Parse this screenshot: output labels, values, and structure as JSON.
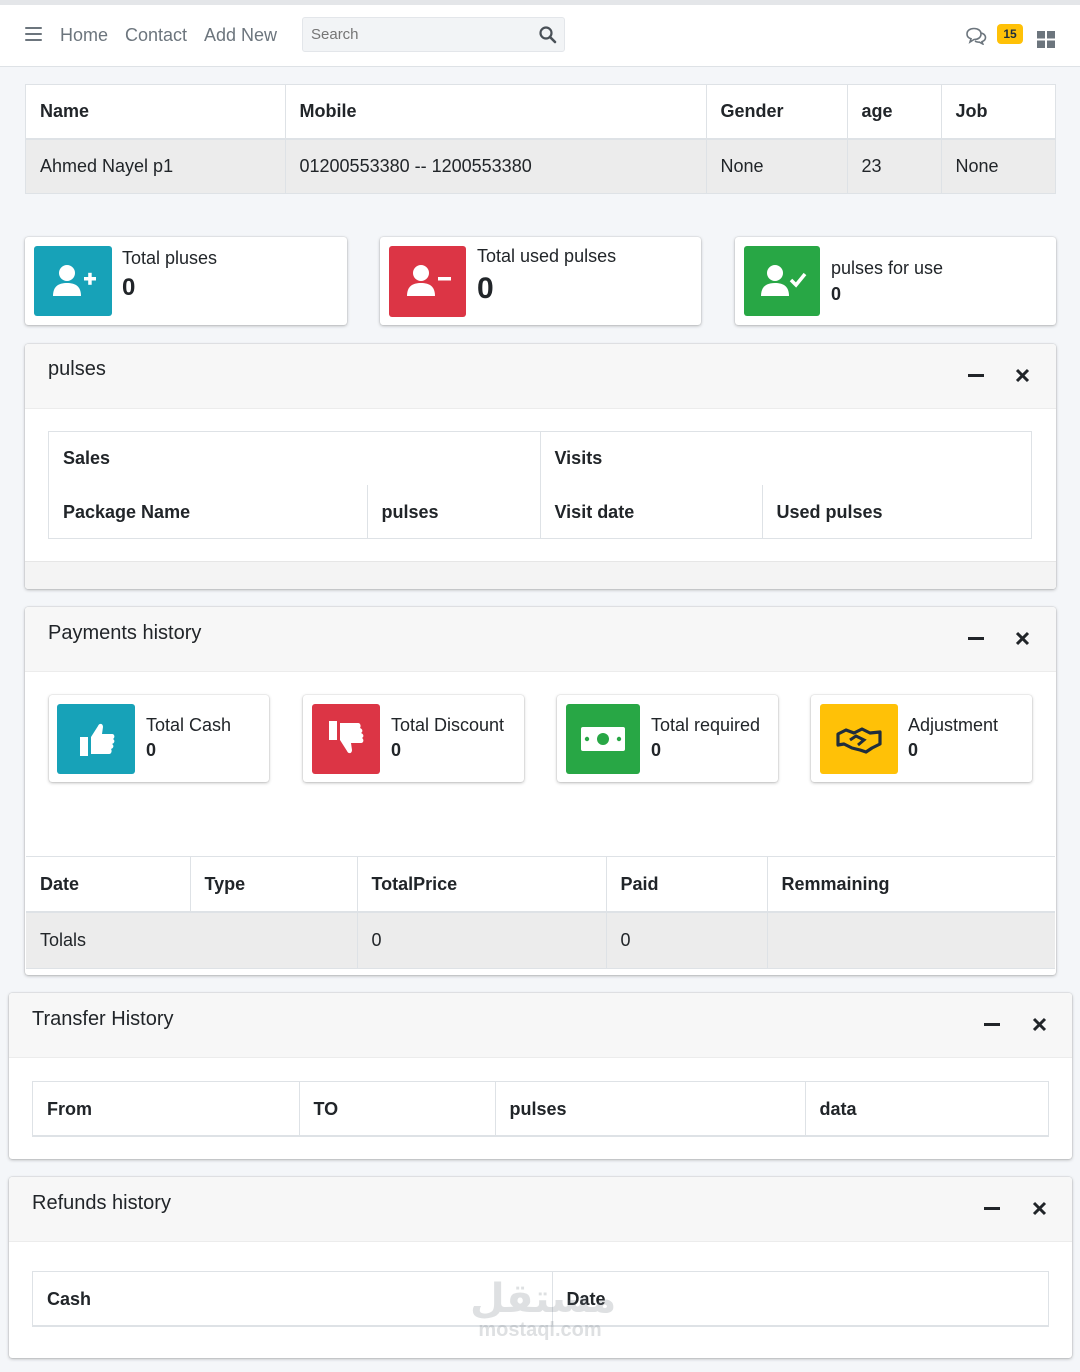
{
  "navbar": {
    "links": [
      "Home",
      "Contact",
      "Add New"
    ],
    "search_placeholder": "Search",
    "messages_badge": "15"
  },
  "customer_table": {
    "headers": [
      "Name",
      "Mobile",
      "Gender",
      "age",
      "Job"
    ],
    "row": [
      "Ahmed Nayel p1",
      "01200553380 -- 1200553380",
      "None",
      "23",
      "None"
    ]
  },
  "stats": [
    {
      "label": "Total pluses",
      "value": "0",
      "icon": "user-plus-icon",
      "color": "#17a2b8"
    },
    {
      "label": "Total used pulses",
      "value": "0",
      "icon": "user-minus-icon",
      "color": "#dc3545"
    },
    {
      "label": "pulses for use",
      "value": "0",
      "icon": "user-check-icon",
      "color": "#28a745"
    }
  ],
  "pulses_card": {
    "title": "pulses",
    "group_headers": [
      "Sales",
      "Visits"
    ],
    "columns": [
      "Package Name",
      "pulses",
      "Visit date",
      "Used pulses"
    ]
  },
  "payments_card": {
    "title": "Payments history",
    "boxes": [
      {
        "label": "Total Cash",
        "value": "0",
        "icon": "thumbs-up-icon",
        "color": "#17a2b8"
      },
      {
        "label": "Total Discount",
        "value": "0",
        "icon": "thumbs-down-icon",
        "color": "#dc3545"
      },
      {
        "label": "Total required",
        "value": "0",
        "icon": "money-bill-icon",
        "color": "#28a745"
      },
      {
        "label": "Adjustment",
        "value": "0",
        "icon": "handshake-icon",
        "color": "#ffc107"
      }
    ],
    "columns": [
      "Date",
      "Type",
      "TotalPrice",
      "Paid",
      "Remmaining"
    ],
    "totals_row": [
      "Tolals",
      "0",
      "0",
      ""
    ]
  },
  "transfer_card": {
    "title": "Transfer History",
    "columns": [
      "From",
      "TO",
      "pulses",
      "data"
    ]
  },
  "refunds_card": {
    "title": "Refunds history",
    "columns": [
      "Cash",
      "Date"
    ]
  },
  "watermark": {
    "arabic": "مستقل",
    "latin": "mostaql.com"
  }
}
